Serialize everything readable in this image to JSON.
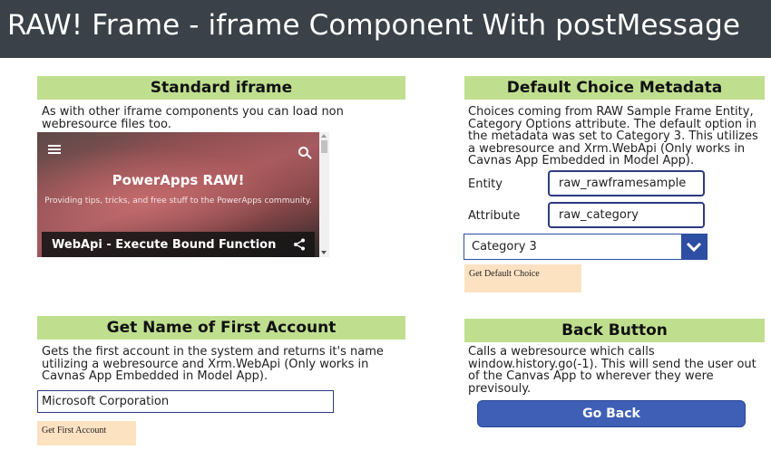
{
  "title": "RAW! Frame - iframe Component With postMessage",
  "standard_iframe": {
    "header": "Standard iframe",
    "description": "As with other iframe components you can load non webresource files too.",
    "preview": {
      "site_title": "PowerApps RAW!",
      "site_subtitle": "Providing tips, tricks, and free stuff to the PowerApps community.",
      "post_title": "WebApi - Execute Bound Function",
      "icons": [
        "menu-icon",
        "search-icon",
        "share-icon"
      ]
    }
  },
  "default_choice": {
    "header": "Default Choice Metadata",
    "description": "Choices coming from RAW Sample Frame Entity, Category Options attribute.  The default option in the metadata was set to Category 3.  This utilizes a webresource and Xrm.WebApi (Only works in Cavnas App Embedded in Model App).",
    "entity_label": "Entity",
    "entity_value": "raw_rawframesample",
    "attribute_label": "Attribute",
    "attribute_value": "raw_category",
    "dropdown_value": "Category 3",
    "button_label": "Get Default Choice"
  },
  "first_account": {
    "header": "Get Name of First Account",
    "description": "Gets the first account in the system and returns it's name utilizing a webresource and Xrm.WebApi (Only works in Cavnas App Embedded in Model App).",
    "result_value": "Microsoft Corporation",
    "button_label": "Get First Account"
  },
  "back_button": {
    "header": "Back Button",
    "description": "Calls a webresource which calls window.history.go(-1). This will send the user out of the Canvas App to wherever they were previsouly.",
    "button_label": "Go Back"
  },
  "colors": {
    "title_bar": "#3b4148",
    "section_header": "#bfdf8f",
    "accent_blue": "#3e5fb5",
    "action_button": "#fde2c2"
  }
}
